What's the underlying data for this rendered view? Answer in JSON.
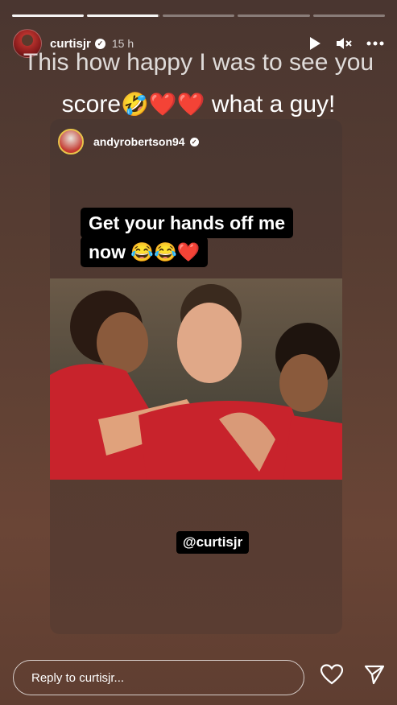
{
  "story": {
    "username": "curtisjr",
    "time": "15 h",
    "progress_segments": [
      "done",
      "active",
      "pending",
      "pending",
      "pending"
    ]
  },
  "caption": {
    "line1": "This how happy I was to see you",
    "line2_prefix": "score",
    "line2_emojis": "🤣❤️❤️",
    "line2_suffix": " what a guy!"
  },
  "shared_post": {
    "username": "andyrobertson94",
    "quote_line1": "Get your hands off me",
    "quote_line2": "now 😂😂❤️",
    "mention": "@curtisjr"
  },
  "reply": {
    "placeholder": "Reply to curtisjr..."
  },
  "icons": [
    "play-icon",
    "mute-icon",
    "more-icon",
    "heart-icon",
    "send-icon",
    "verified-icon"
  ]
}
